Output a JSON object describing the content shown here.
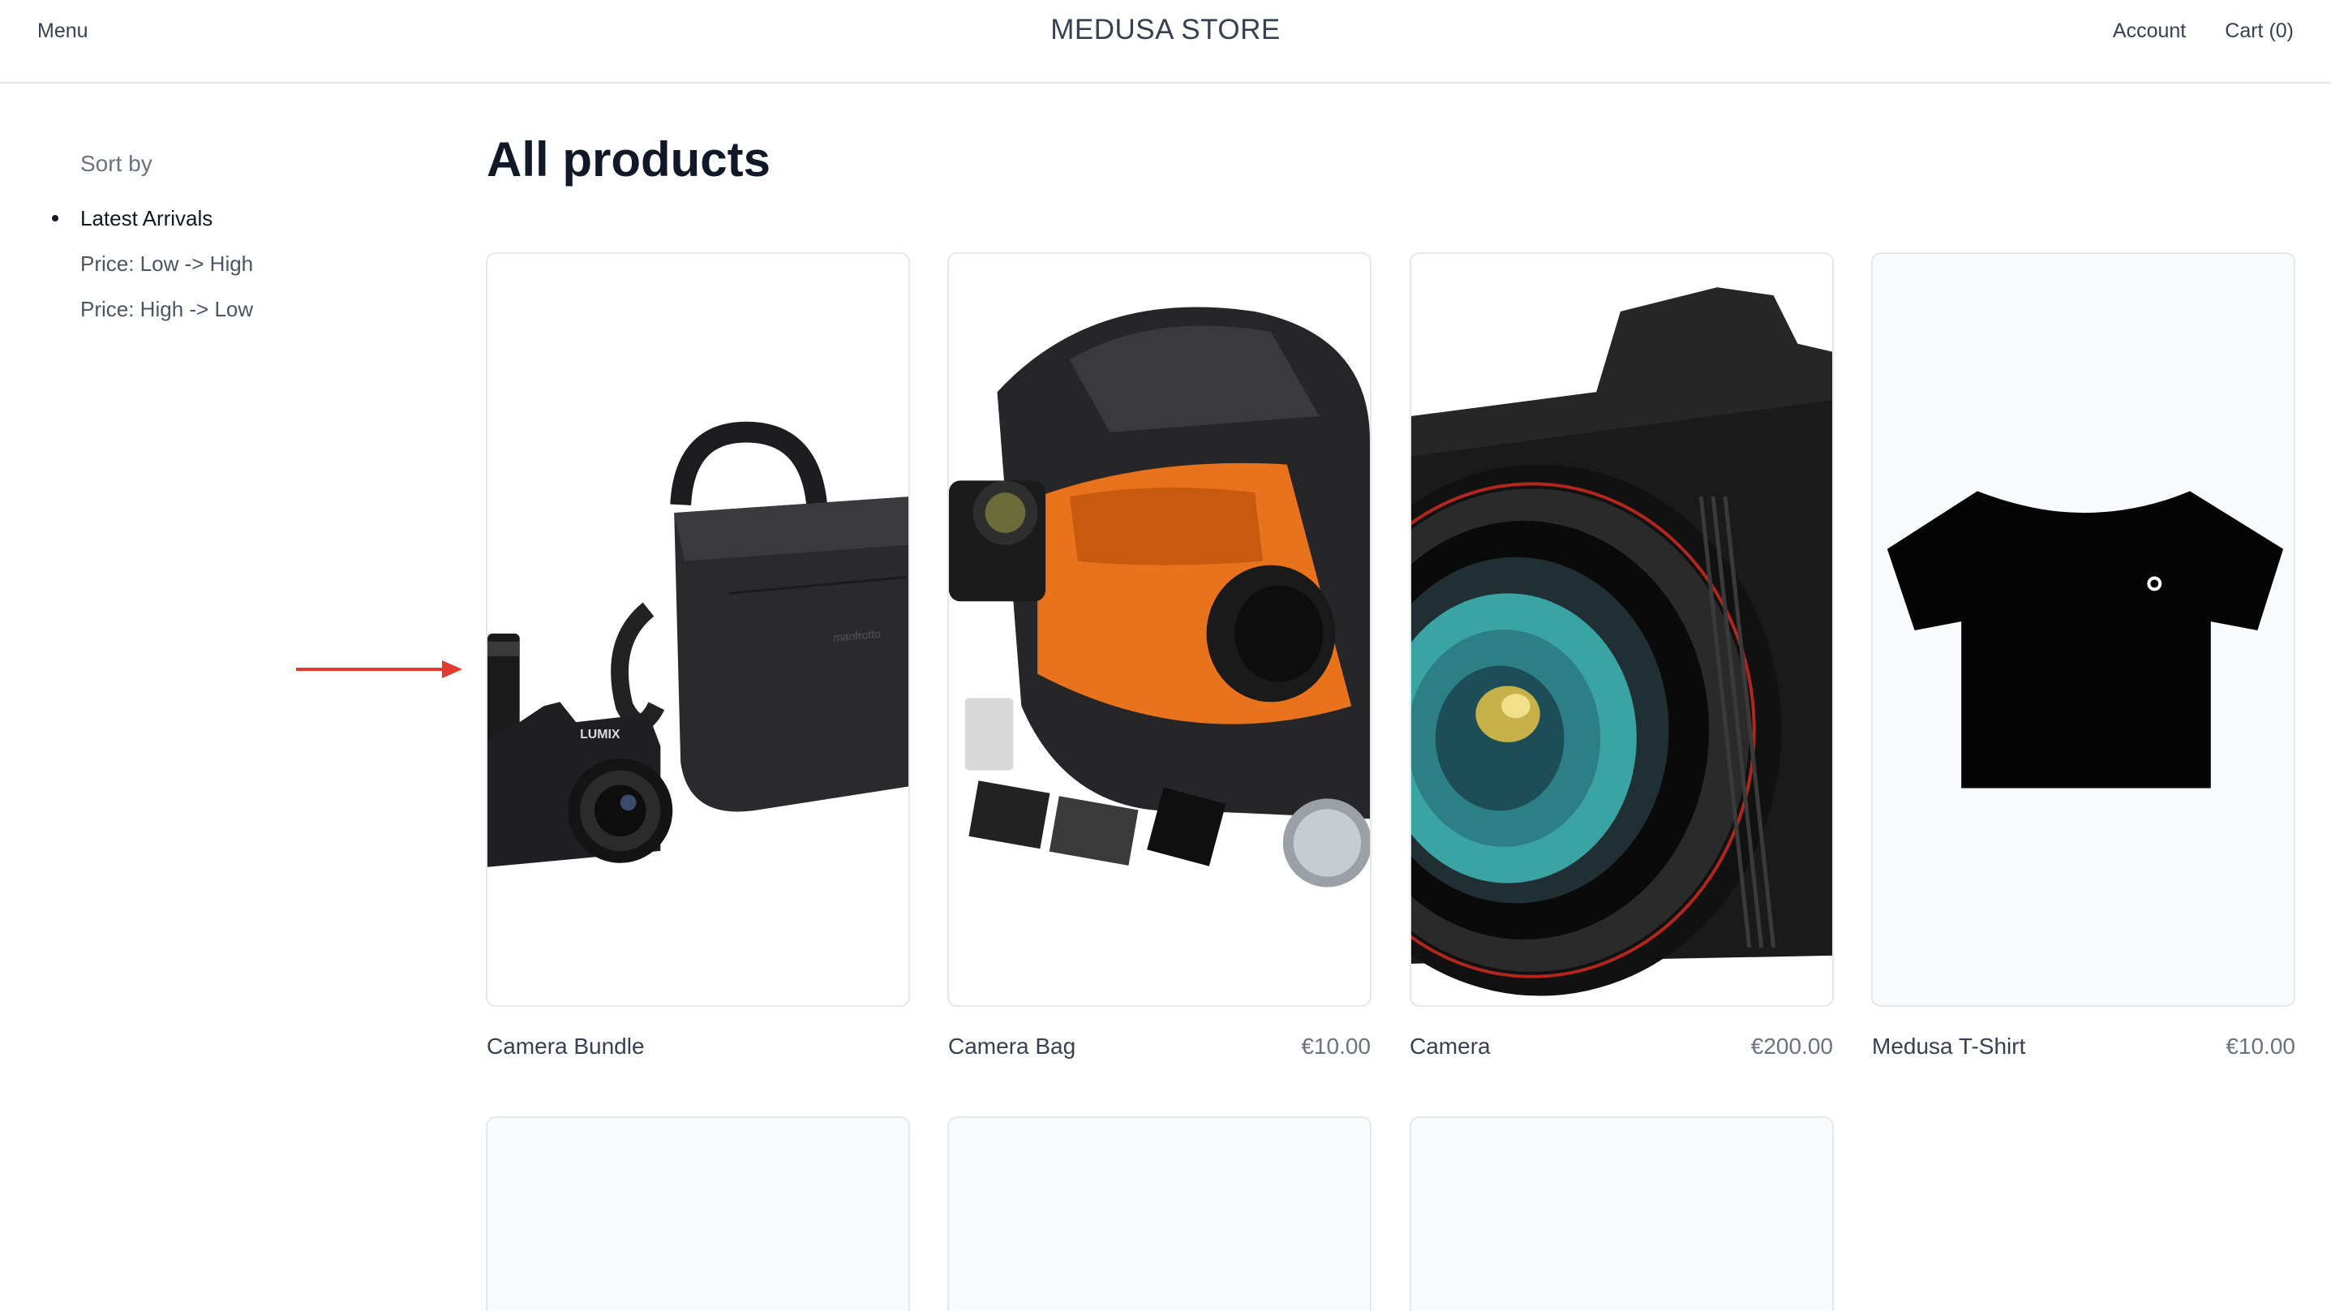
{
  "header": {
    "menu": "Menu",
    "brand": "MEDUSA STORE",
    "account": "Account",
    "cart": "Cart (0)"
  },
  "sort": {
    "title": "Sort by",
    "options": [
      "Latest Arrivals",
      "Price: Low -> High",
      "Price: High -> Low"
    ],
    "selected": "Latest Arrivals"
  },
  "main": {
    "heading": "All products",
    "products": [
      {
        "name": "Camera Bundle",
        "price": "",
        "image": "camera-bundle-image"
      },
      {
        "name": "Camera Bag",
        "price": "€10.00",
        "image": "camera-bag-image"
      },
      {
        "name": "Camera",
        "price": "€200.00",
        "image": "camera-lens-image"
      },
      {
        "name": "Medusa T-Shirt",
        "price": "€10.00",
        "image": "tshirt-image"
      }
    ]
  },
  "colors": {
    "annotation_arrow": "#e23b2e",
    "placeholder_bg": "#f9fafb",
    "border": "#e5e7eb"
  }
}
